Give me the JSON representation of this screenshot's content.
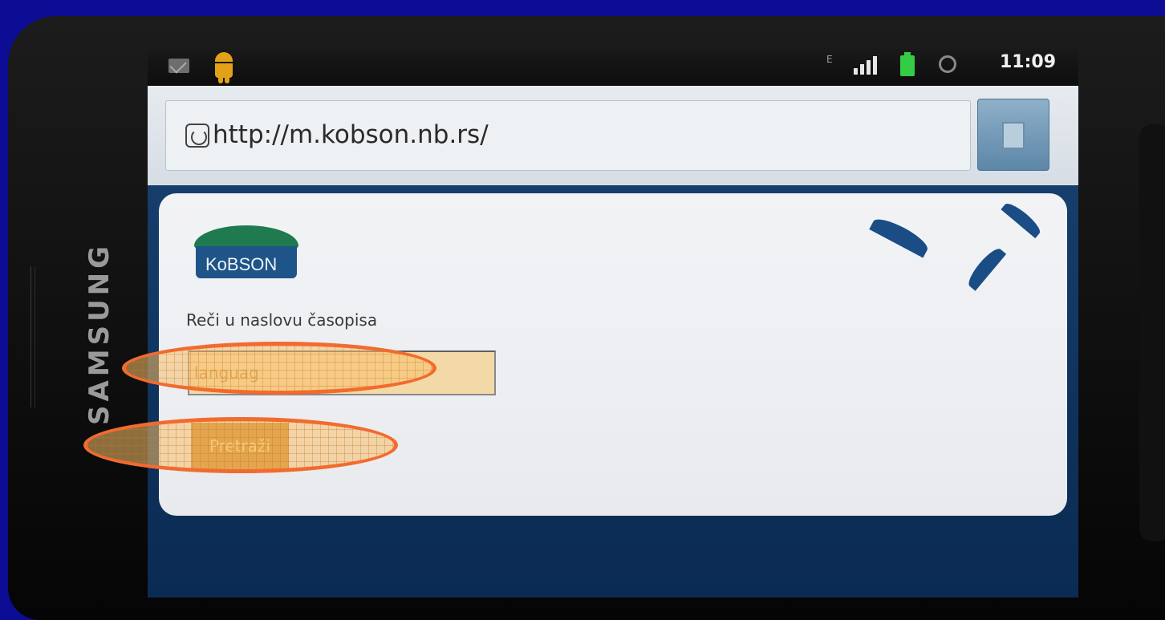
{
  "device": {
    "brand": "SAMSUNG"
  },
  "status_bar": {
    "time": "11:09",
    "network_label": "E",
    "signal_bars": 4,
    "icons": [
      "mail-icon",
      "android-icon",
      "signal-icon",
      "battery-icon",
      "alarm-icon"
    ]
  },
  "browser": {
    "url": "http://m.kobson.nb.rs/",
    "bookmark_icon": "bookmark-icon"
  },
  "page": {
    "logo_text": "KoBSON",
    "search_label": "Reči u naslovu časopisa",
    "search_value": "languag",
    "search_button_label": "Pretraži"
  },
  "colors": {
    "background": "#0c0c94",
    "annotation": "#f26b2e",
    "highlight": "#f8c06a",
    "card": "#eceef2",
    "page_blue": "#163e6c"
  }
}
